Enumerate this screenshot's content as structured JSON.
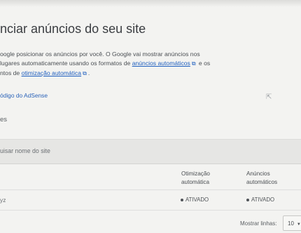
{
  "title": "nciar anúncios do seu site",
  "description": {
    "line1": "oogle posicionar os anúncios por você. O Google vai mostrar anúncios nos",
    "line2_pre": "lugares automaticamente usando os formatos de ",
    "line2_link": "anúncios automáticos",
    "line2_post": " e os",
    "line3_pre": "ntos de ",
    "line3_link": "otimização automática",
    "line3_post": "."
  },
  "code_link": "ódigo do AdSense",
  "section_label": "es",
  "search": {
    "placeholder": "uisar nome do site"
  },
  "table": {
    "headers": {
      "optimization": [
        "Otimização",
        "automática"
      ],
      "auto_ads": [
        "Anúncios",
        "automáticos"
      ]
    },
    "rows": [
      {
        "site": "yz",
        "optimization_status": "ATIVADO",
        "auto_ads_status": "ATIVADO"
      }
    ]
  },
  "pagination": {
    "label": "Mostrar linhas:",
    "value": "10"
  },
  "icons": {
    "external": "external-link-icon",
    "cursor": "mouse-cursor-icon",
    "dropdown": "chevron-down-icon"
  }
}
